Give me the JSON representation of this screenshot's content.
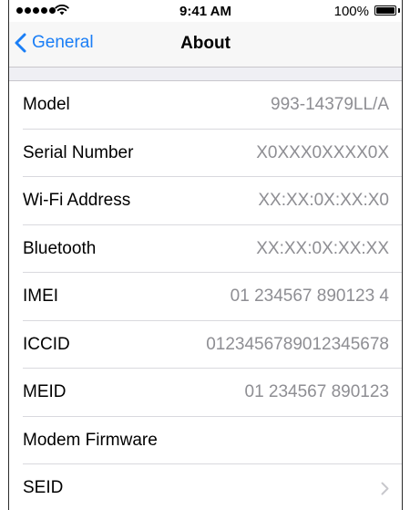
{
  "status_bar": {
    "time": "9:41 AM",
    "battery_percent": "100%",
    "battery_level": 1.0,
    "signal_bars": 5,
    "icons": [
      "signal-dots-icon",
      "wifi-icon",
      "battery-icon"
    ]
  },
  "nav": {
    "back_label": "General",
    "title": "About",
    "accent_color": "#1a7ef6"
  },
  "rows": [
    {
      "label": "Model",
      "value": "993-14379LL/A"
    },
    {
      "label": "Serial Number",
      "value": "X0XXX0XXXX0X"
    },
    {
      "label": "Wi-Fi Address",
      "value": "XX:XX:0X:XX:X0"
    },
    {
      "label": "Bluetooth",
      "value": "XX:XX:0X:XX:XX"
    },
    {
      "label": "IMEI",
      "value": "01 234567 890123 4"
    },
    {
      "label": "ICCID",
      "value": "0123456789012345678"
    },
    {
      "label": "MEID",
      "value": "01 234567 890123"
    },
    {
      "label": "Modem Firmware",
      "value": ""
    },
    {
      "label": "SEID",
      "value": "",
      "icon": "chevron-right-icon"
    }
  ]
}
